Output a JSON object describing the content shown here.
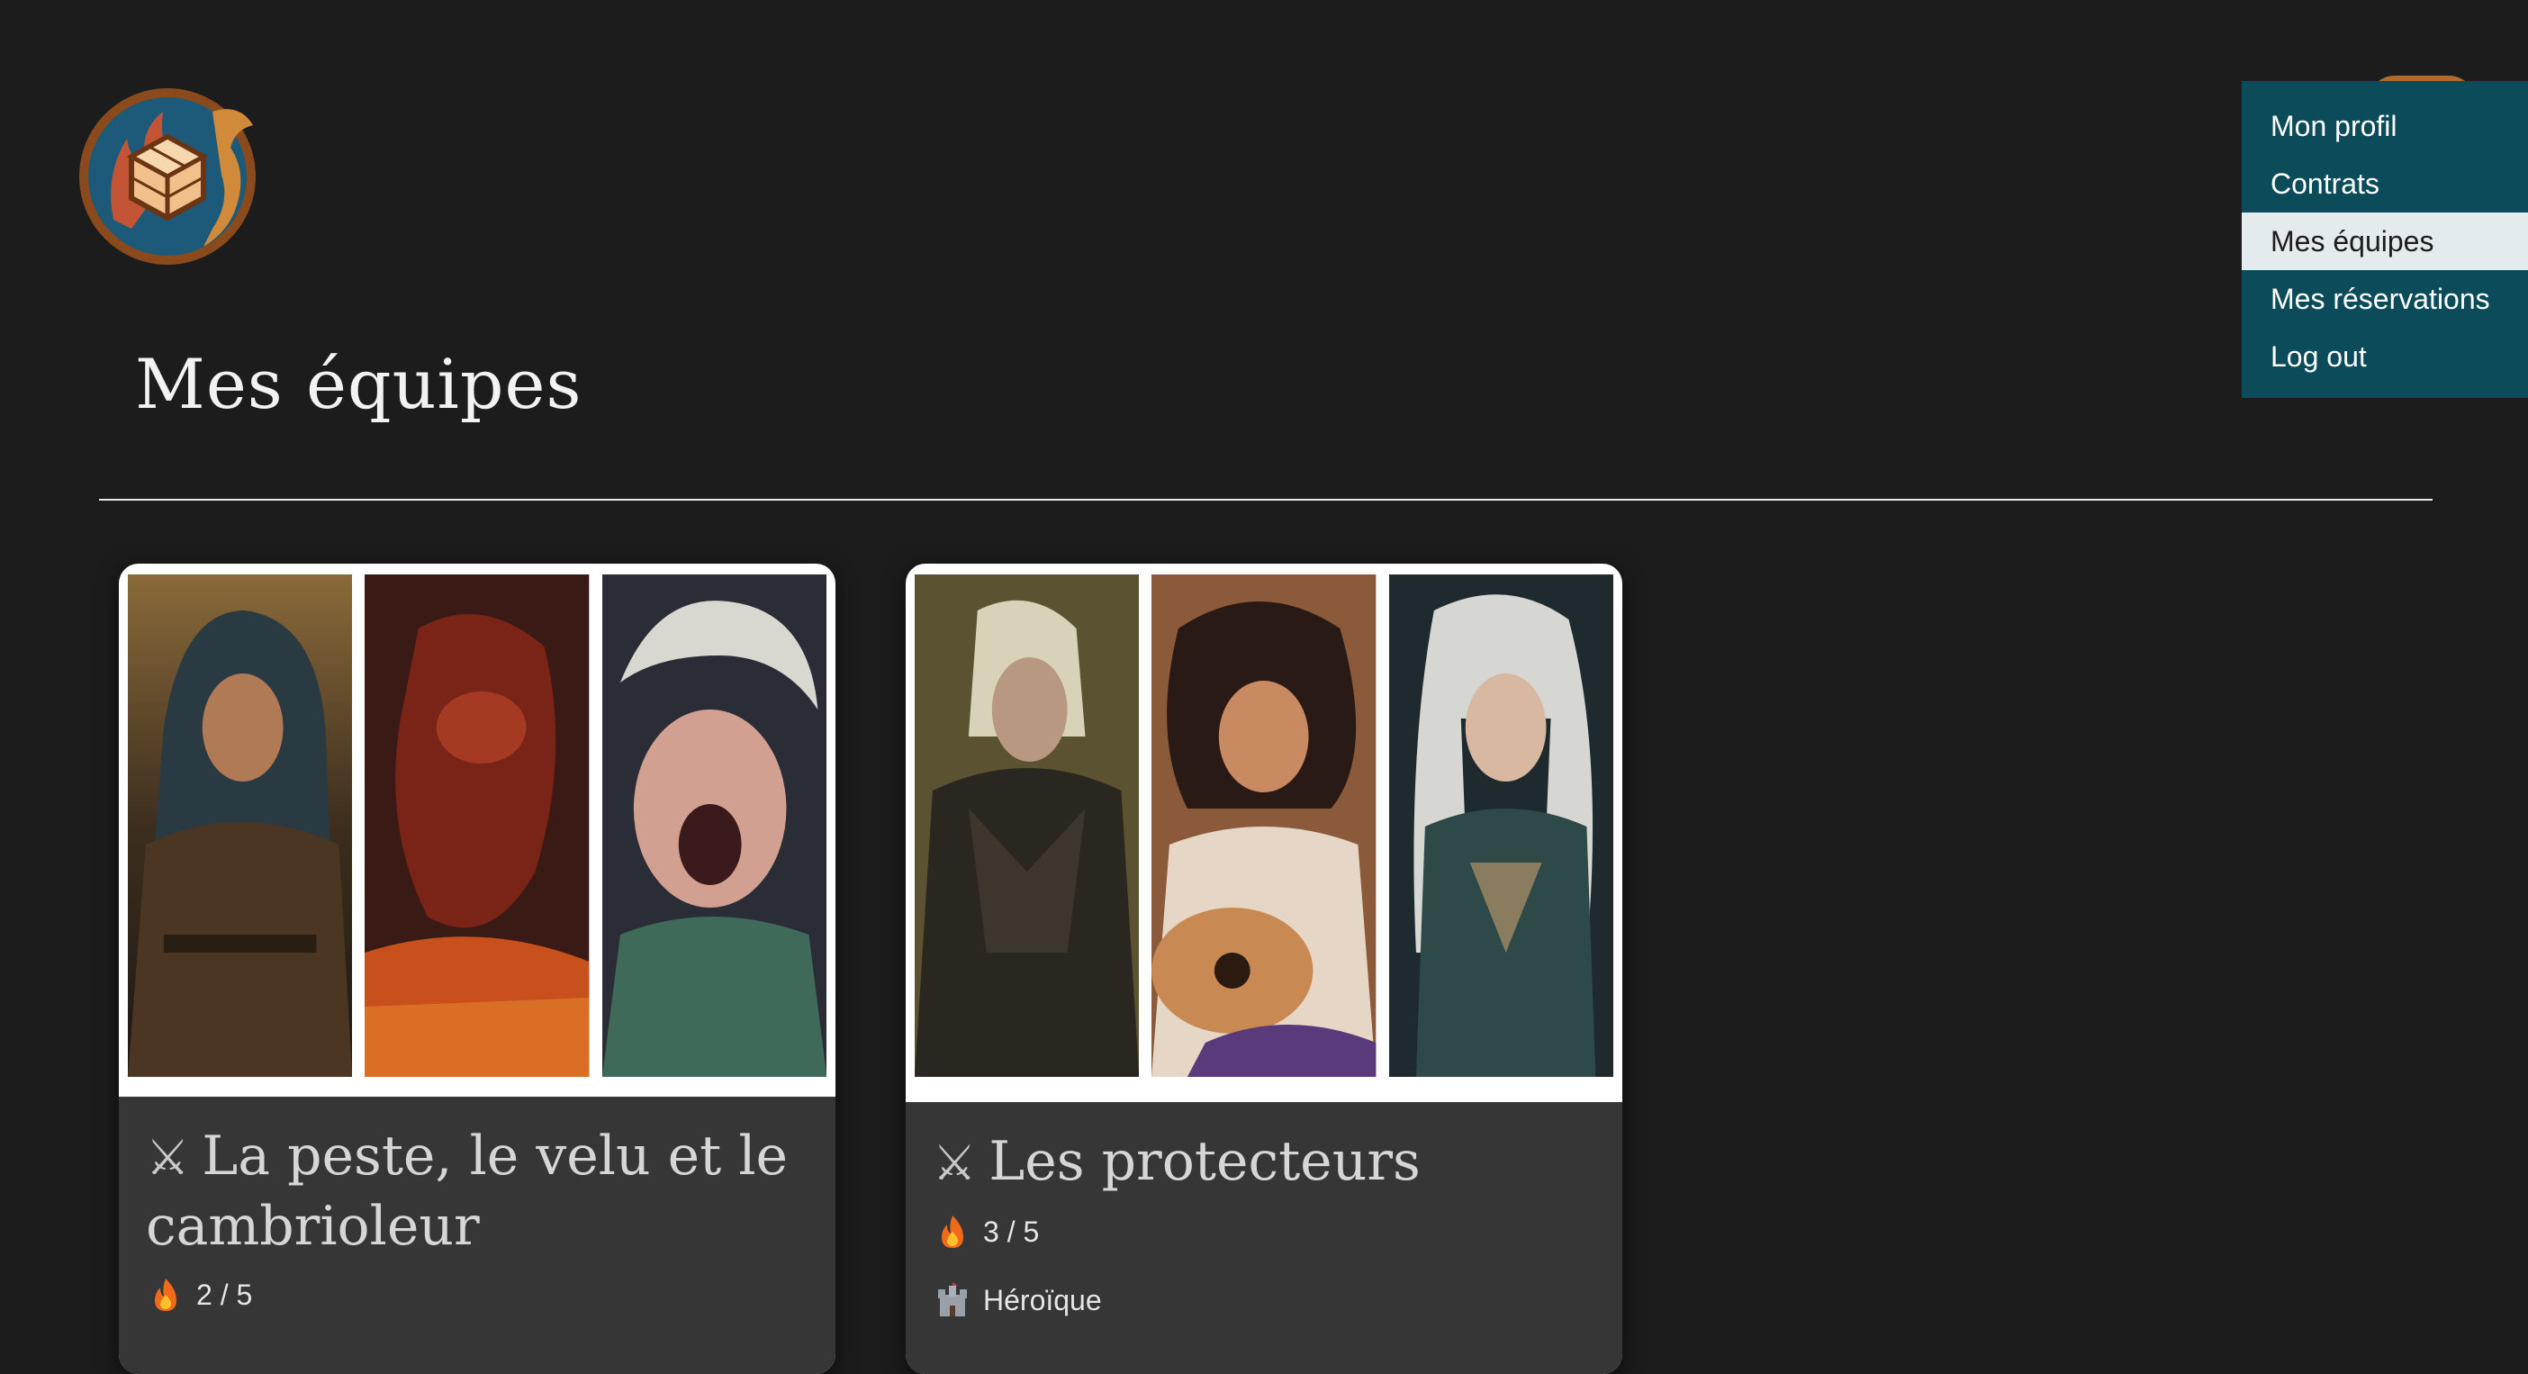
{
  "page": {
    "title": "Mes équipes"
  },
  "menu": {
    "items": [
      {
        "label": "Mon profil",
        "active": false
      },
      {
        "label": "Contrats",
        "active": false
      },
      {
        "label": "Mes équipes",
        "active": true
      },
      {
        "label": "Mes réservations",
        "active": false
      },
      {
        "label": "Log out",
        "active": false
      }
    ]
  },
  "teams": [
    {
      "name": "La peste, le velu et le cambrioleur",
      "icon": "crossed-swords-icon",
      "count": "2 / 5"
    },
    {
      "name": "Les protecteurs",
      "icon": "crossed-swords-icon",
      "count": "3 / 5",
      "difficulty": "Héroïque"
    }
  ],
  "colors": {
    "background": "#1c1c1c",
    "menu_background": "#0b4b5a",
    "menu_active_background": "#e3ebee",
    "card_footer": "#363636"
  }
}
